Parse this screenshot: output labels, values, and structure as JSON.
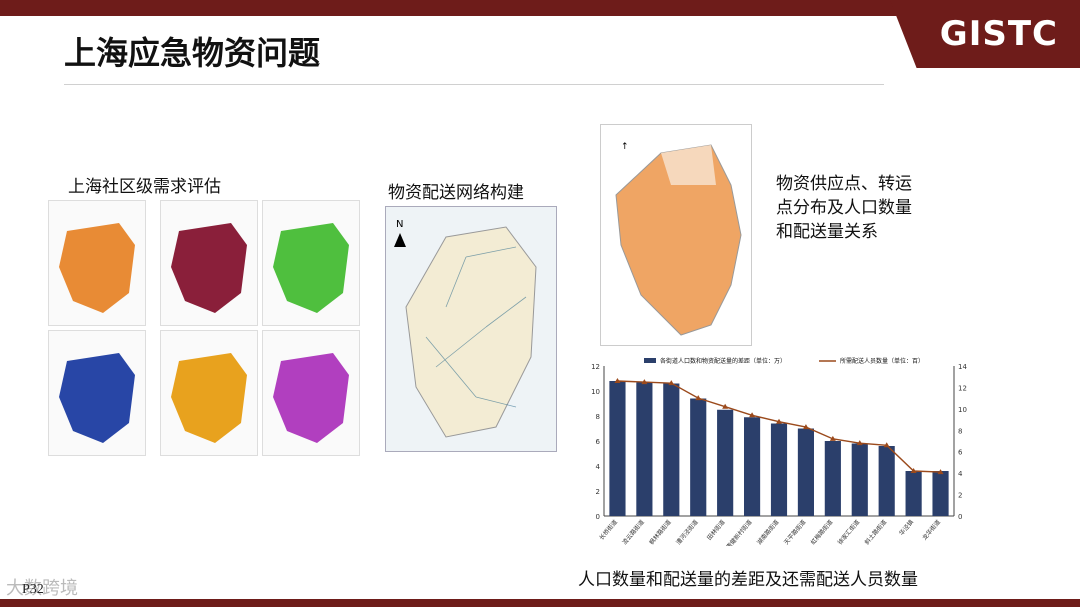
{
  "brand": {
    "logo": "GISTC"
  },
  "page": {
    "title": "上海应急物资问题",
    "page_number": "P32",
    "watermark": "大数跨境"
  },
  "labels": {
    "community": "上海社区级需求评估",
    "network": "物资配送网络构建",
    "supply_line1": "物资供应点、转运",
    "supply_line2": "点分布及人口数量",
    "supply_line3": "和配送量关系",
    "caption": "人口数量和配送量的差距及还需配送人员数量"
  },
  "colors": {
    "accent": "#6e1c1a",
    "bar": "#2b3f6b",
    "line": "#9b4a1c"
  },
  "chart_data": {
    "type": "bar",
    "categories": [
      "长桥街道",
      "凌云路街道",
      "枫林路街道",
      "漕河泾街道",
      "田林街道",
      "康健新村街道",
      "湖南路街道",
      "天平路街道",
      "虹梅路街道",
      "徐家汇街道",
      "斜土路街道",
      "华泾镇",
      "龙华街道"
    ],
    "series": [
      {
        "name": "各街道人口数和物资配送量的差距（单位：万）",
        "type": "bar",
        "values": [
          10.8,
          10.7,
          10.6,
          9.4,
          8.5,
          7.9,
          7.4,
          7.0,
          6.0,
          5.8,
          5.6,
          3.6,
          3.6
        ]
      },
      {
        "name": "所需配送人员数量（单位：百）",
        "type": "line",
        "values": [
          12.6,
          12.5,
          12.4,
          11.0,
          10.2,
          9.4,
          8.8,
          8.3,
          7.2,
          6.8,
          6.6,
          4.2,
          4.1
        ]
      }
    ],
    "ylim": [
      0,
      12
    ],
    "y2lim": [
      0,
      14
    ],
    "yticks": [
      "0",
      "2",
      "4",
      "6",
      "8",
      "10",
      "12"
    ],
    "y2ticks": [
      "0",
      "2",
      "4",
      "6",
      "8",
      "10",
      "12",
      "14"
    ],
    "legend": "top"
  }
}
